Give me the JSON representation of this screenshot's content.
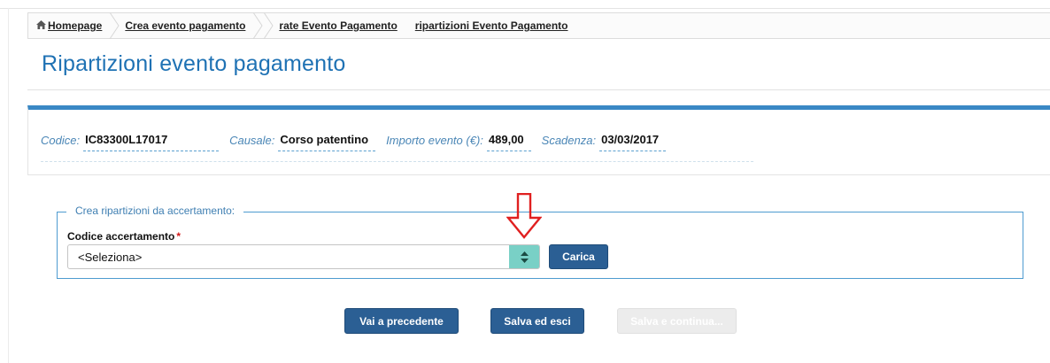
{
  "breadcrumb": {
    "items": [
      {
        "label": "Homepage"
      },
      {
        "label": "Crea evento pagamento"
      },
      {
        "label": "rate Evento Pagamento"
      },
      {
        "label": "ripartizioni Evento Pagamento"
      }
    ]
  },
  "page": {
    "title": "Ripartizioni evento pagamento"
  },
  "info": {
    "codice_label": "Codice:",
    "codice_value": "IC83300L17017",
    "causale_label": "Causale:",
    "causale_value": "Corso patentino",
    "importo_label": "Importo evento (€):",
    "importo_value": "489,00",
    "scadenza_label": "Scadenza:",
    "scadenza_value": "03/03/2017"
  },
  "form": {
    "legend": "Crea ripartizioni da accertamento:",
    "field_label": "Codice accertamento",
    "required_mark": "*",
    "select_value": "<Seleziona>",
    "carica_label": "Carica"
  },
  "actions": {
    "prev_label": "Vai a precedente",
    "save_exit_label": "Salva ed esci",
    "save_continue_label": "Salva e continua..."
  },
  "colors": {
    "accent": "#1f72b4",
    "button": "#2b5f94",
    "select_arrow_bg": "#79d0c6",
    "annotation_arrow": "#e02020"
  }
}
